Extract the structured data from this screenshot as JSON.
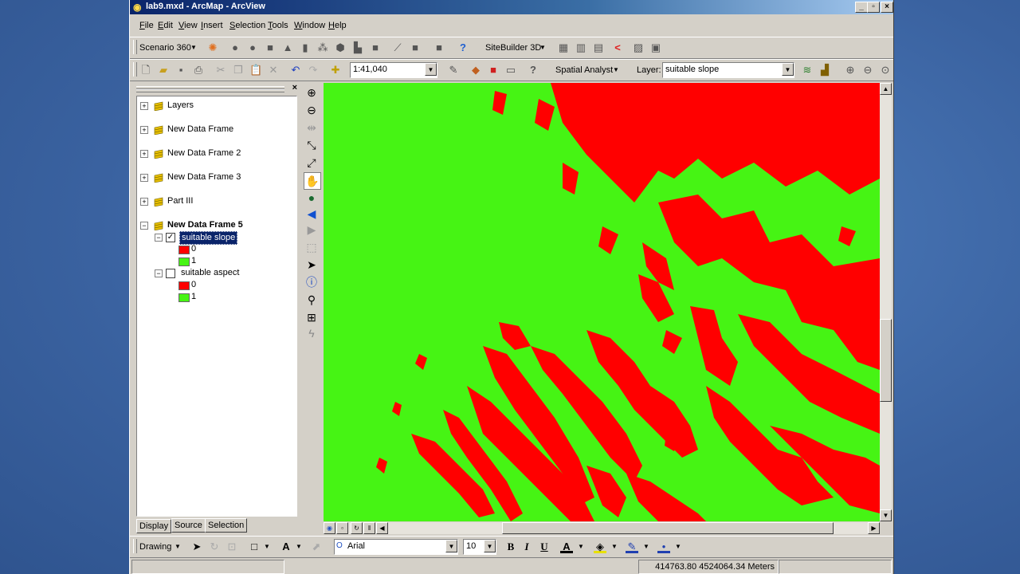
{
  "window": {
    "title": "lab9.mxd - ArcMap - ArcView"
  },
  "menu": [
    "File",
    "Edit",
    "View",
    "Insert",
    "Selection",
    "Tools",
    "Window",
    "Help"
  ],
  "toolbar3d": {
    "scenario": "Scenario 360",
    "sitebuilder": "SiteBuilder 3D"
  },
  "standard": {
    "scale": "1:41,040",
    "spatial_analyst": "Spatial Analyst",
    "layer_label": "Layer:",
    "layer_value": "suitable slope"
  },
  "toc": {
    "frames": [
      "Layers",
      "New Data Frame",
      "New Data Frame 2",
      "New Data Frame 3",
      "Part III"
    ],
    "active_frame": "New Data Frame 5",
    "layers": [
      {
        "name": "suitable slope",
        "checked": true,
        "selected": true,
        "legend": [
          {
            "label": "0",
            "color": "#ff0000"
          },
          {
            "label": "1",
            "color": "#46f414"
          }
        ]
      },
      {
        "name": "suitable aspect",
        "checked": false,
        "selected": false,
        "legend": [
          {
            "label": "0",
            "color": "#ff0000"
          },
          {
            "label": "1",
            "color": "#46f414"
          }
        ]
      }
    ],
    "tabs": [
      "Display",
      "Source",
      "Selection"
    ]
  },
  "map": {
    "background_color": "#46f414",
    "raster_color": "#ff0000"
  },
  "drawing": {
    "label": "Drawing",
    "font": "Arial",
    "size": "10",
    "bold": "B",
    "italic": "I",
    "underline": "U",
    "font_color_glyph": "A"
  },
  "status": {
    "coords": "414763.80  4524064.34 Meters"
  }
}
